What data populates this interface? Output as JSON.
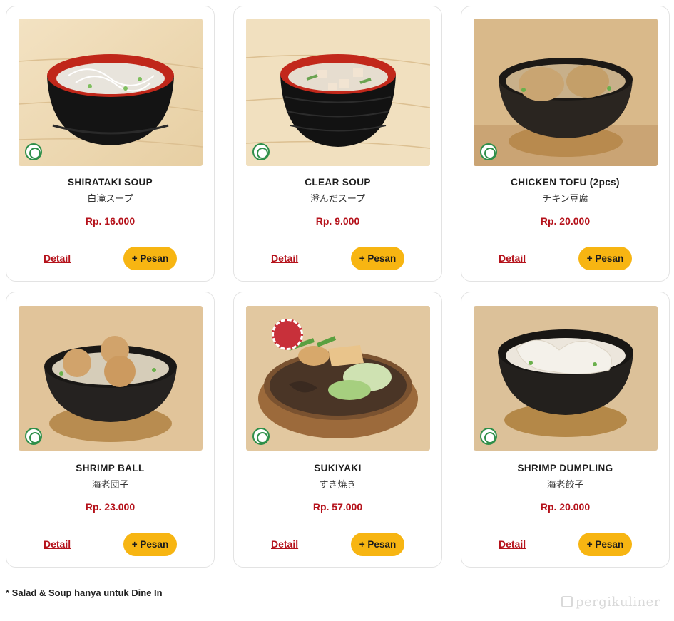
{
  "menu": {
    "items": [
      {
        "name": "SHIRATAKI SOUP",
        "jp": "白滝スープ",
        "price": "Rp. 16.000",
        "detail_label": "Detail",
        "order_label": "+ Pesan",
        "bowl": "red",
        "content": "noodle"
      },
      {
        "name": "CLEAR SOUP",
        "jp": "澄んだスープ",
        "price": "Rp. 9.000",
        "detail_label": "Detail",
        "order_label": "+ Pesan",
        "bowl": "red",
        "content": "tofu"
      },
      {
        "name": "CHICKEN TOFU (2pcs)",
        "jp": "チキン豆腐",
        "price": "Rp. 20.000",
        "detail_label": "Detail",
        "order_label": "+ Pesan",
        "bowl": "dark",
        "content": "balls2"
      },
      {
        "name": "SHRIMP BALL",
        "jp": "海老団子",
        "price": "Rp. 23.000",
        "detail_label": "Detail",
        "order_label": "+ Pesan",
        "bowl": "dark",
        "content": "balls3"
      },
      {
        "name": "SUKIYAKI",
        "jp": "すき焼き",
        "price": "Rp. 57.000",
        "detail_label": "Detail",
        "order_label": "+ Pesan",
        "bowl": "pot",
        "content": "sukiyaki"
      },
      {
        "name": "SHRIMP DUMPLING",
        "jp": "海老餃子",
        "price": "Rp. 20.000",
        "detail_label": "Detail",
        "order_label": "+ Pesan",
        "bowl": "dark",
        "content": "dumpling"
      }
    ]
  },
  "footer": {
    "note": "* Salad & Soup hanya untuk Dine In",
    "watermark": "pergikuliner"
  },
  "colors": {
    "accent_yellow": "#f7b512",
    "price_red": "#b5121b",
    "card_border": "#e3e3e3"
  },
  "icons": {
    "halal": "halal-badge-icon",
    "beef_badge": "beef-badge-icon",
    "watermark": "camera-icon"
  }
}
